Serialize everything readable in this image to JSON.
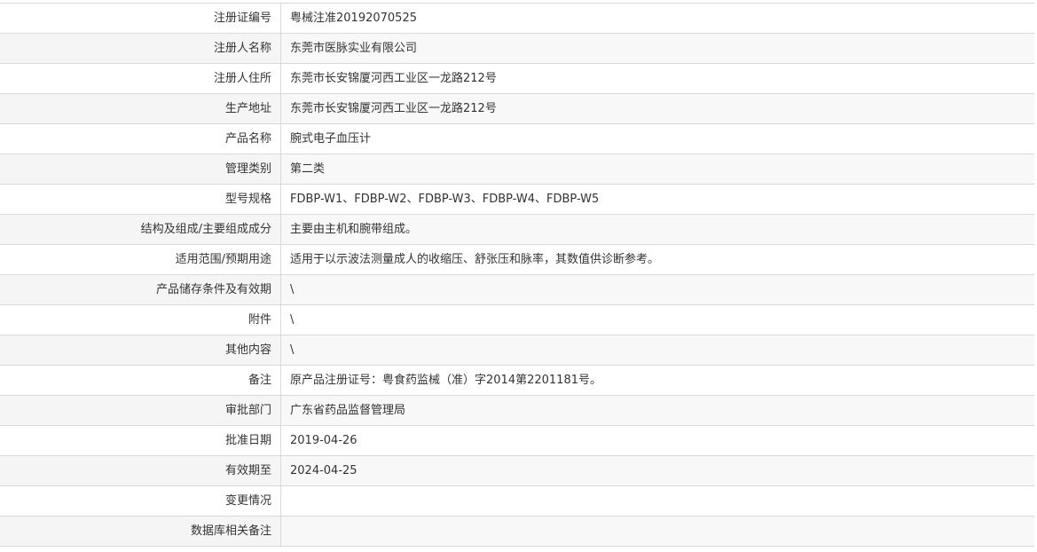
{
  "rows": [
    {
      "label": "注册证编号",
      "value": "粤械注准20192070525"
    },
    {
      "label": "注册人名称",
      "value": "东莞市医脉实业有限公司"
    },
    {
      "label": "注册人住所",
      "value": "东莞市长安锦厦河西工业区一龙路212号"
    },
    {
      "label": "生产地址",
      "value": "东莞市长安锦厦河西工业区一龙路212号"
    },
    {
      "label": "产品名称",
      "value": "腕式电子血压计"
    },
    {
      "label": "管理类别",
      "value": "第二类"
    },
    {
      "label": "型号规格",
      "value": "FDBP-W1、FDBP-W2、FDBP-W3、FDBP-W4、FDBP-W5"
    },
    {
      "label": "结构及组成/主要组成成分",
      "value": "主要由主机和腕带组成。"
    },
    {
      "label": "适用范围/预期用途",
      "value": "适用于以示波法测量成人的收缩压、舒张压和脉率，其数值供诊断参考。"
    },
    {
      "label": "产品储存条件及有效期",
      "value": "\\"
    },
    {
      "label": "附件",
      "value": "\\"
    },
    {
      "label": "其他内容",
      "value": "\\"
    },
    {
      "label": "备注",
      "value": "原产品注册证号：粤食药监械（准）字2014第2201181号。"
    },
    {
      "label": "审批部门",
      "value": "广东省药品监督管理局"
    },
    {
      "label": "批准日期",
      "value": "2019-04-26"
    },
    {
      "label": "有效期至",
      "value": "2024-04-25"
    },
    {
      "label": "变更情况",
      "value": ""
    },
    {
      "label": "数据库相关备注",
      "value": ""
    }
  ]
}
